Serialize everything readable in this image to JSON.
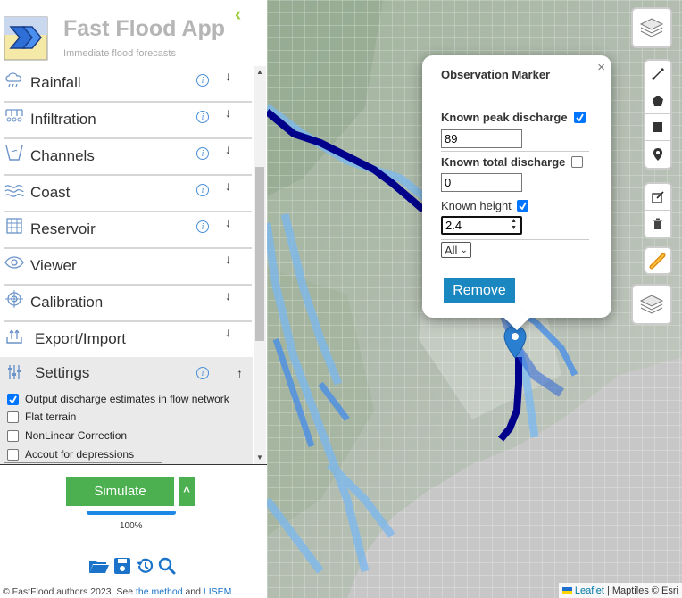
{
  "app": {
    "title": "Fast Flood App",
    "subtitle": "Immediate flood forecasts",
    "collapse_icon": "chevron-left-icon"
  },
  "menu": [
    {
      "label": "Rainfall",
      "icon": "rain-cloud-icon",
      "has_info": true
    },
    {
      "label": "Infiltration",
      "icon": "infiltration-icon",
      "has_info": true
    },
    {
      "label": "Channels",
      "icon": "channel-icon",
      "has_info": true
    },
    {
      "label": "Coast",
      "icon": "waves-icon",
      "has_info": true
    },
    {
      "label": "Reservoir",
      "icon": "dam-icon",
      "has_info": true
    },
    {
      "label": "Viewer",
      "icon": "eye-icon",
      "has_info": false
    },
    {
      "label": "Calibration",
      "icon": "target-icon",
      "has_info": false
    },
    {
      "label": "Export/Import",
      "icon": "upload-icon",
      "has_info": false
    }
  ],
  "menu_arrow": "↓",
  "info_glyph": "i",
  "settings": {
    "label": "Settings",
    "arrow": "↑",
    "options": [
      {
        "label": "Output discharge estimates in flow network",
        "checked": true
      },
      {
        "label": "Flat terrain",
        "checked": false
      },
      {
        "label": "NonLinear Correction",
        "checked": false
      },
      {
        "label": "Accout for depressions",
        "checked": false
      }
    ]
  },
  "simulate": {
    "label": "Simulate",
    "toggle": "^",
    "progress": 1.0,
    "progress_label": "100%"
  },
  "tools": [
    "folder-open-icon",
    "save-icon",
    "history-icon",
    "search-icon"
  ],
  "footer": {
    "text_before": "© FastFlood authors 2023. See ",
    "method_link": "the method",
    "text_mid": " and ",
    "lisem_link": "LISEM"
  },
  "popup": {
    "title": "Observation Marker",
    "close": "×",
    "fields": [
      {
        "label": "Known peak discharge",
        "checked": true,
        "value": "89"
      },
      {
        "label": "Known total discharge",
        "checked": false,
        "value": "0"
      },
      {
        "label": "Known height",
        "checked": true,
        "value": "2.4"
      }
    ],
    "select_value": "All",
    "remove_label": "Remove"
  },
  "map_controls": {
    "layers_icon": "layers-icon",
    "draw_tools": [
      "polyline-icon",
      "polygon-icon",
      "rectangle-icon",
      "marker-icon"
    ],
    "edit_tools": [
      "edit-icon",
      "trash-icon"
    ],
    "pen_icon": "pen-icon"
  },
  "attribution": {
    "leaflet": "Leaflet",
    "rest": "| Maptiles © Esri"
  },
  "colors": {
    "accent_green": "#4caf50",
    "river_dark": "#00008b",
    "river_mid": "#1e5bd8",
    "river_light": "#7ab8f0",
    "button_blue": "#1a87c0",
    "title_gray": "#b5b5b5"
  }
}
